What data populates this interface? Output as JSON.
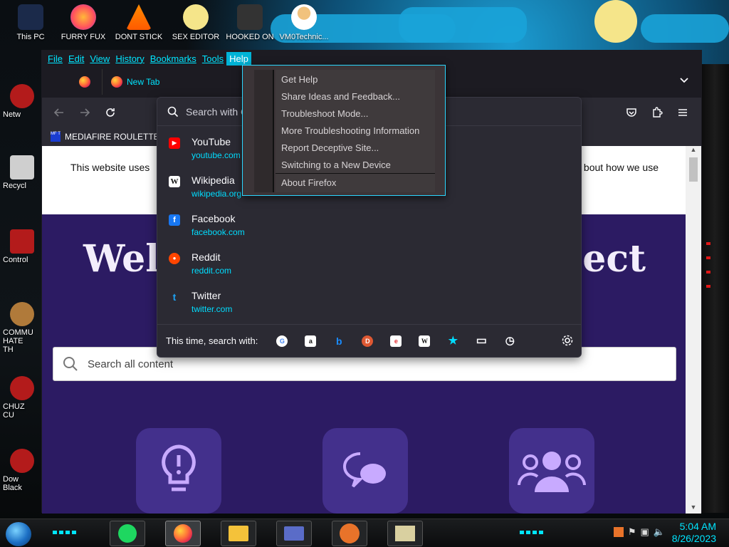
{
  "desktop": {
    "top_icons": [
      {
        "label": "This PC"
      },
      {
        "label": "FURRY FUX"
      },
      {
        "label": "DONT STICK"
      },
      {
        "label": "SEX EDITOR"
      },
      {
        "label": "HOOKED ON"
      },
      {
        "label": "VM0Technic..."
      }
    ],
    "left_icons": [
      {
        "label": "Netw"
      },
      {
        "label": "Recycl"
      },
      {
        "label": "Control"
      },
      {
        "label": "COMMU HATE TH"
      },
      {
        "label": "CHUZ CU"
      },
      {
        "label": "Dow Black"
      }
    ]
  },
  "menubar": {
    "items": [
      "File",
      "Edit",
      "View",
      "History",
      "Bookmarks",
      "Tools",
      "Help"
    ],
    "active": "Help"
  },
  "tabs": {
    "active_tab_label": "New Tab",
    "list_all_tabs_icon": "chevron-down-icon"
  },
  "bookmarks_toolbar": {
    "items": [
      {
        "label": "MEDIAFIRE ROULETTER",
        "icon_text": "MF T"
      }
    ]
  },
  "page": {
    "cookie_left": "This website uses",
    "cookie_right": "bout how we use",
    "welcome_left": "Welc",
    "welcome_right": "nect",
    "search_placeholder": "Search all content"
  },
  "urlbar": {
    "placeholder": "Search with G",
    "suggestions": [
      {
        "title": "YouTube",
        "url": "youtube.com",
        "color": "#ff0000",
        "glyph": "▶"
      },
      {
        "title": "Wikipedia",
        "url": "wikipedia.org",
        "color": "#ffffff",
        "glyph": "W"
      },
      {
        "title": "Facebook",
        "url": "facebook.com",
        "color": "#1877f2",
        "glyph": "f"
      },
      {
        "title": "Reddit",
        "url": "reddit.com",
        "color": "#ff4500",
        "glyph": "●"
      },
      {
        "title": "Twitter",
        "url": "twitter.com",
        "color": "#1da1f2",
        "glyph": "t"
      }
    ],
    "one_off_label": "This time, search with:",
    "engines": [
      {
        "name": "google-icon",
        "glyph": "G",
        "bg": "#ffffff",
        "fg": "#4285f4"
      },
      {
        "name": "amazon-icon",
        "glyph": "a",
        "bg": "#ffffff",
        "fg": "#111111"
      },
      {
        "name": "bing-icon",
        "glyph": "b",
        "bg": "transparent",
        "fg": "#1a8cff"
      },
      {
        "name": "duckduckgo-icon",
        "glyph": "D",
        "bg": "#de5833",
        "fg": "#ffffff"
      },
      {
        "name": "ebay-icon",
        "glyph": "e",
        "bg": "#ffffff",
        "fg": "#e53238"
      },
      {
        "name": "wikipedia-icon",
        "glyph": "W",
        "bg": "#ffffff",
        "fg": "#111111"
      },
      {
        "name": "bookmarks-star-icon",
        "glyph": "★",
        "bg": "transparent",
        "fg": "#00ddff"
      },
      {
        "name": "tabs-icon",
        "glyph": "▭",
        "bg": "transparent",
        "fg": "#fbfbfe"
      },
      {
        "name": "history-clock-icon",
        "glyph": "◷",
        "bg": "transparent",
        "fg": "#fbfbfe"
      }
    ]
  },
  "help_menu": {
    "items": [
      "Get Help",
      "Share Ideas and Feedback...",
      "Troubleshoot Mode...",
      "More Troubleshooting Information",
      "Report Deceptive Site...",
      "Switching to a New Device",
      "About Firefox"
    ]
  },
  "taskbar": {
    "time": "5:04 AM",
    "date": "8/26/2023"
  },
  "colors": {
    "accent": "#00e5ff",
    "page_purple": "#2c1b63",
    "menu_bg": "#3b3437"
  }
}
